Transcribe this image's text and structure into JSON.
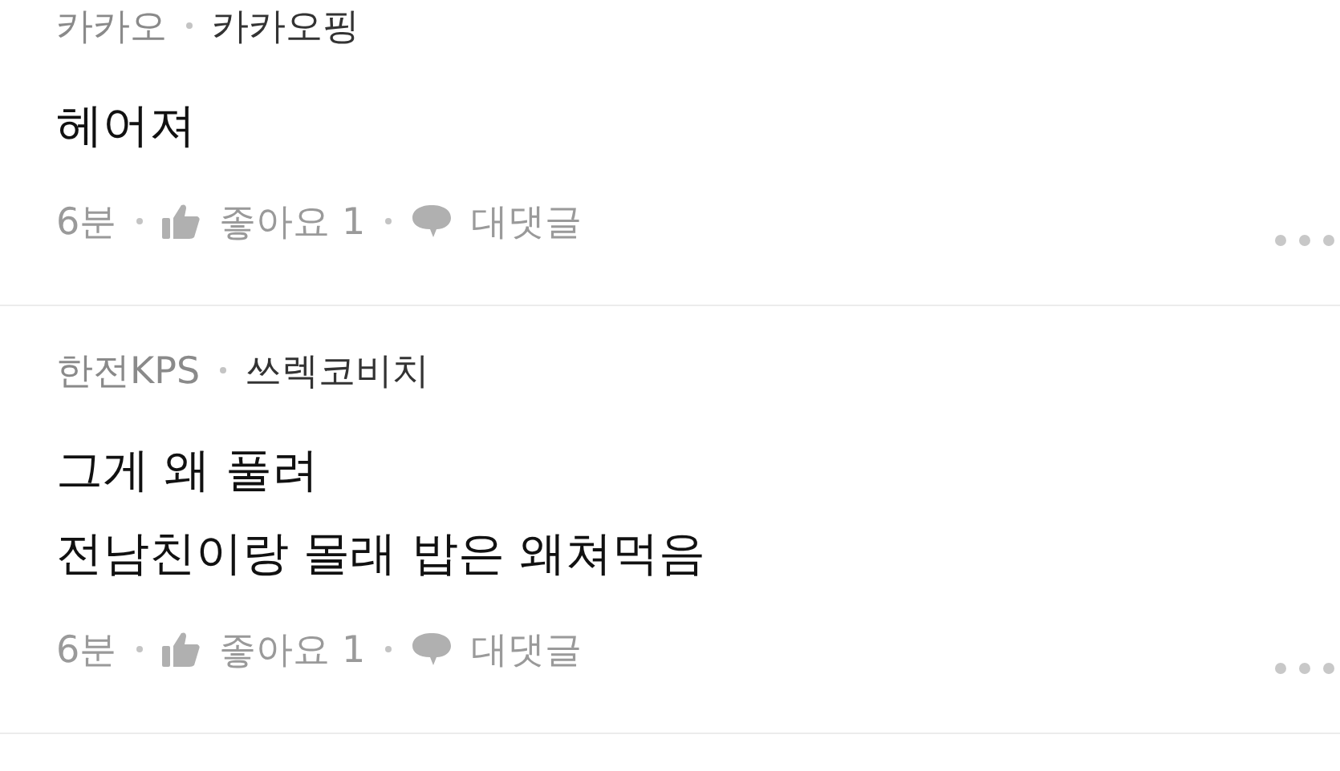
{
  "comments": [
    {
      "company": "카카오",
      "nickname": "카카오핑",
      "lines": [
        "헤어져"
      ],
      "time": "6분",
      "like_label": "좋아요 1",
      "reply_label": "대댓글"
    },
    {
      "company": "한전KPS",
      "nickname": "쓰렉코비치",
      "lines": [
        "그게 왜 풀려",
        "전남친이랑 몰래 밥은 왜쳐먹음"
      ],
      "time": "6분",
      "like_label": "좋아요 1",
      "reply_label": "대댓글"
    }
  ]
}
